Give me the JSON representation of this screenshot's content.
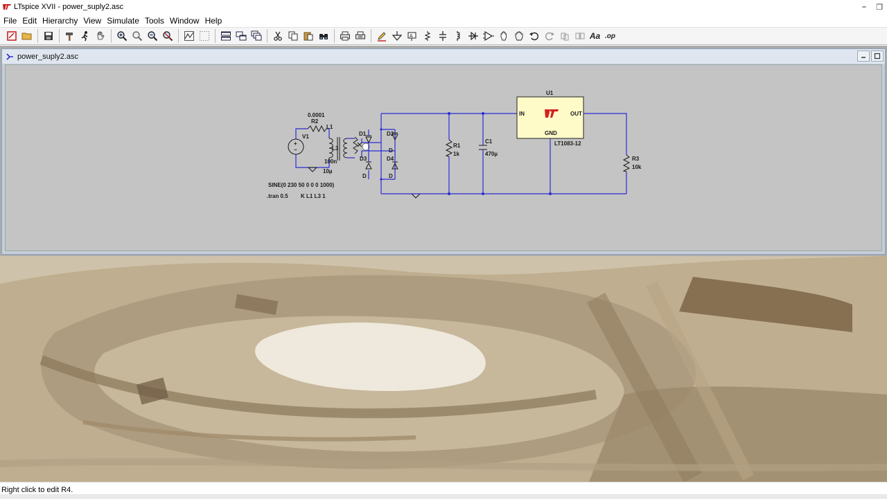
{
  "window": {
    "title": "LTspice XVII - power_suply2.asc",
    "minimize_glyph": "⎯",
    "restore_glyph": "❐"
  },
  "menu": {
    "items": [
      {
        "label": "File"
      },
      {
        "label": "Edit"
      },
      {
        "label": "Hierarchy"
      },
      {
        "label": "View"
      },
      {
        "label": "Simulate"
      },
      {
        "label": "Tools"
      },
      {
        "label": "Window"
      },
      {
        "label": "Help"
      }
    ]
  },
  "toolbar": {
    "font_button_label": "Aa",
    "spice_directive_label": ".op"
  },
  "document": {
    "title": "power_suply2.asc"
  },
  "schematic": {
    "v1_name": "V1",
    "r2_name": "R2",
    "r2_value": "0.0001",
    "l1_name": "L1",
    "l1_value": "10µ",
    "l3_name": "L3",
    "l3_value": "100n",
    "d1_name": "D1",
    "d2_name": "D2",
    "d3_name": "D3",
    "d4_name": "D4",
    "d_model": "D",
    "r1_name": "R1",
    "r1_value": "1k",
    "c1_name": "C1",
    "c1_value": "470µ",
    "u1_name": "U1",
    "u1_in": "IN",
    "u1_out": "OUT",
    "u1_gnd": "GND",
    "u1_part": "LT1083-12",
    "r3_name": "R3",
    "r3_value": "10k",
    "source_spec": "SINE(0 230 50 0 0 0 1000)",
    "tran_directive": ".tran 0.5",
    "coupling_directive": "K L1 L3 1"
  },
  "colors": {
    "wire": "#2b2bd4",
    "regulator_fill": "#fffbc8",
    "lt_logo_red": "#d42020"
  },
  "status": {
    "text": "Right click to edit R4."
  }
}
